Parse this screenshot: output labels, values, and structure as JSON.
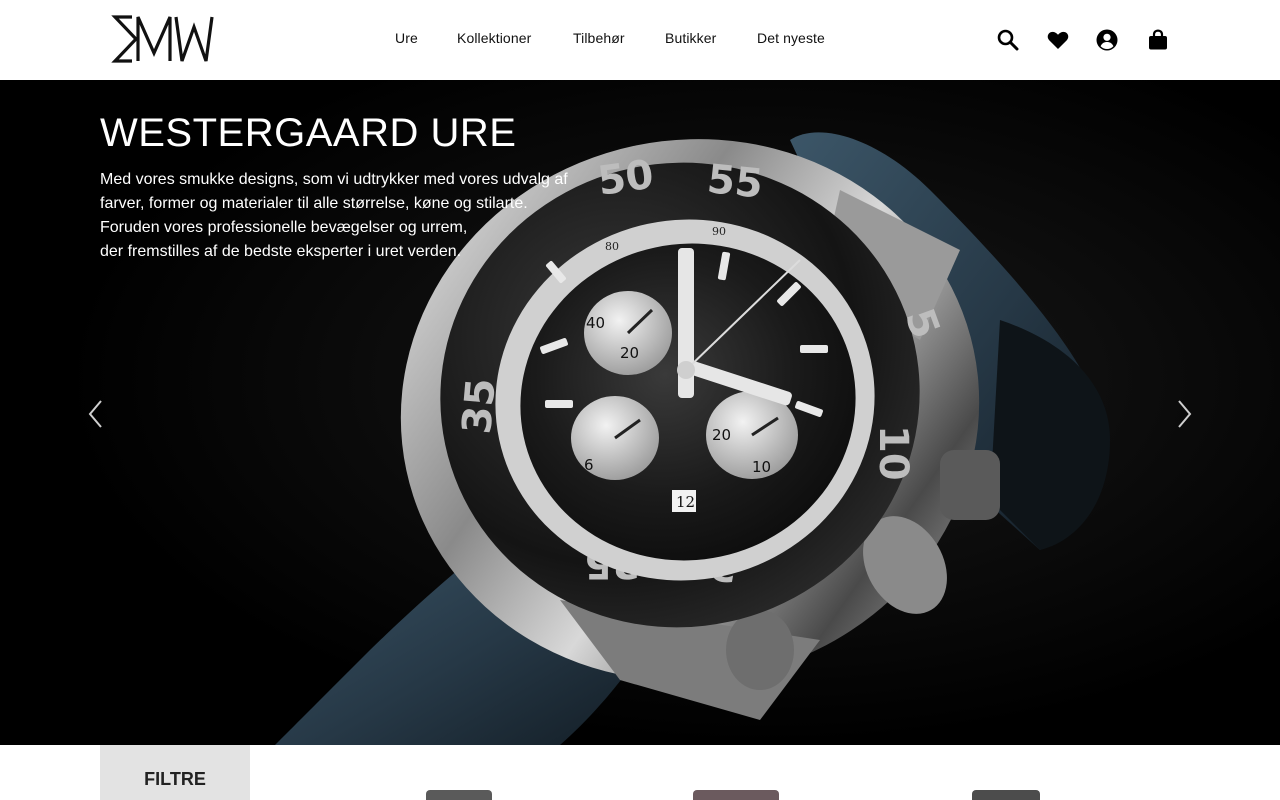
{
  "brand": {
    "logo_text": "SMW"
  },
  "nav": {
    "items": [
      {
        "label": "Ure"
      },
      {
        "label": "Kollektioner"
      },
      {
        "label": "Tilbehør"
      },
      {
        "label": "Butikker"
      },
      {
        "label": "Det nyeste"
      }
    ]
  },
  "header_icons": [
    "search-icon",
    "heart-icon",
    "user-icon",
    "bag-icon"
  ],
  "hero": {
    "title": "WESTERGAARD URE",
    "lines": [
      "Med vores smukke designs, som vi udtrykker med vores udvalg af",
      "farver, former og materialer til alle størrelse, køne og stilarte.",
      "Foruden vores professionelle bevægelser og urrem,",
      "der fremstilles af de bedste eksperter i uret verden."
    ],
    "dial_numbers": [
      "90",
      "80",
      "40",
      "20",
      "12",
      "10",
      "20",
      "10",
      "6",
      "35",
      "25",
      "20",
      "10",
      "50",
      "55",
      "5"
    ]
  },
  "filter": {
    "label": "FILTRE"
  },
  "colors": {
    "hero_bg": "#000000",
    "accent": "#000000",
    "filter_bg": "#e3e3e3"
  }
}
